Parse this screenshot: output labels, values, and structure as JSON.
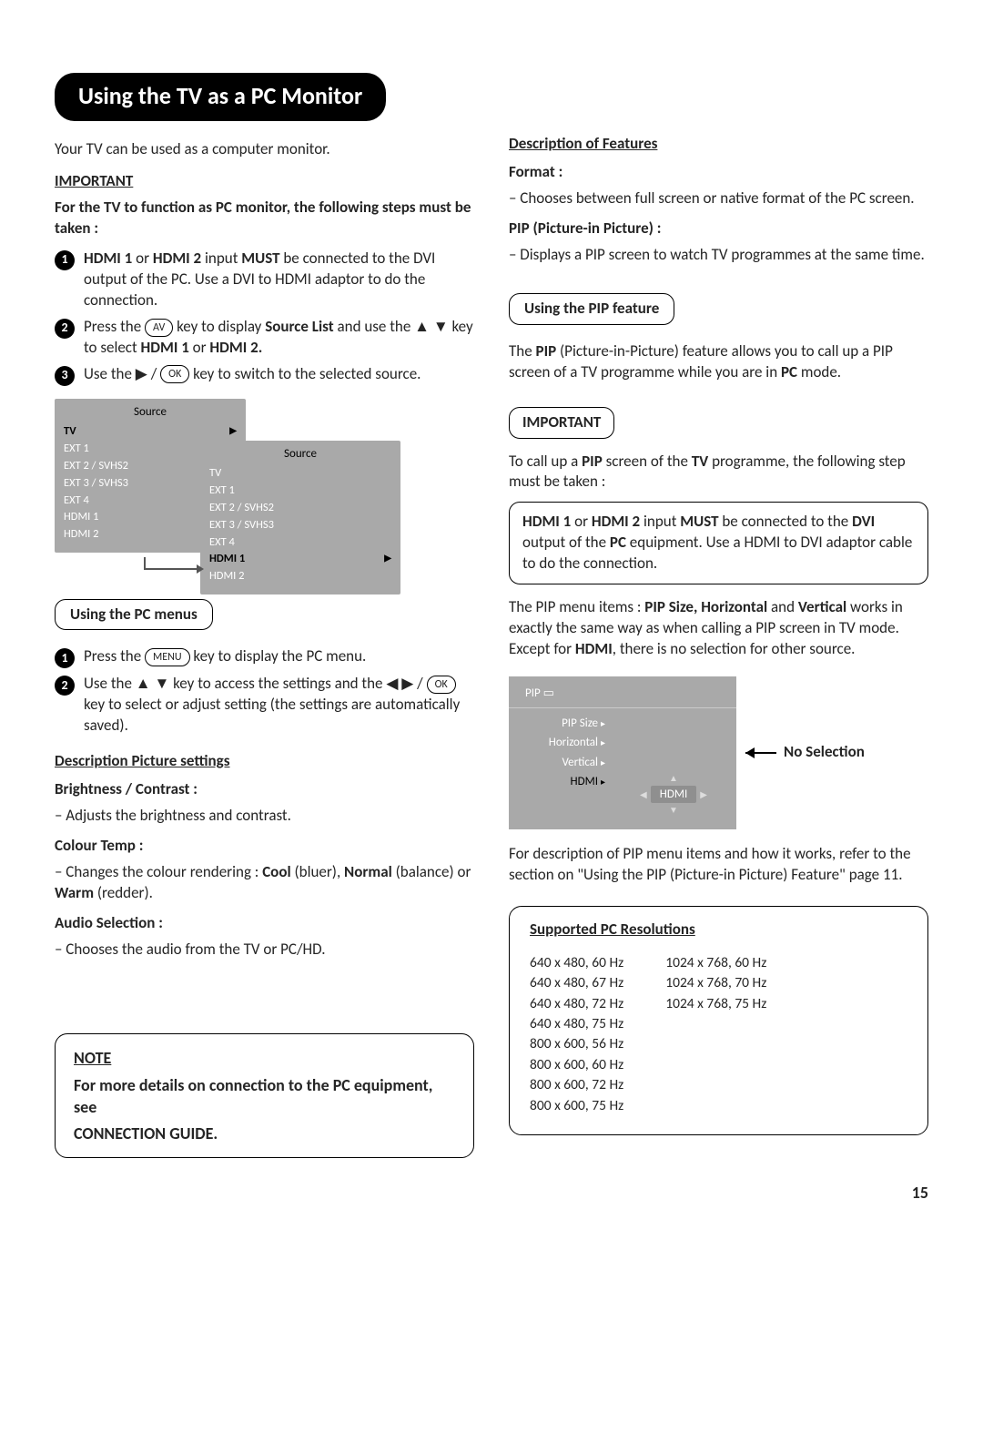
{
  "title": "Using the TV as a PC Monitor",
  "intro": "Your TV can be used as a computer monitor.",
  "important_label": "IMPORTANT",
  "important_text": "For the TV to function as PC monitor, the following steps must be taken :",
  "steps": {
    "s1_a": "HDMI 1",
    "s1_b": " or ",
    "s1_c": "HDMI 2",
    "s1_d": " input ",
    "s1_e": "MUST",
    "s1_f": " be connected to the DVI output of the PC. Use a DVI to HDMI adaptor to do the connection.",
    "s2_a": "Press the ",
    "s2_key": "AV",
    "s2_b": " key to display ",
    "s2_c": "Source List",
    "s2_d": " and use the ▲ ▼ key to select ",
    "s2_e": "HDMI 1",
    "s2_f": " or ",
    "s2_g": "HDMI 2.",
    "s3_a": "Use the ▶ / ",
    "s3_key": "OK",
    "s3_b": " key to switch to the selected source."
  },
  "osd": {
    "title": "Source",
    "items": [
      "TV",
      "EXT 1",
      "EXT 2 / SVHS2",
      "EXT 3 / SVHS3",
      "EXT 4",
      "HDMI 1",
      "HDMI 2"
    ],
    "sel1": "TV",
    "sel2": "HDMI 1"
  },
  "pc_menus_tab": "Using the PC menus",
  "pc_steps": {
    "p1_a": "Press the ",
    "p1_key": "MENU",
    "p1_b": " key to display the PC menu.",
    "p2_a": "Use the ▲ ▼ key to access the settings and the ◀ ▶  / ",
    "p2_key": "OK",
    "p2_b": " key to select or adjust setting (the settings are automatically saved)."
  },
  "desc_pic_h": "Description Picture settings",
  "bright_h": "Brightness / Contrast",
  "bright_t": "– Adjusts the brightness and contrast.",
  "colour_h": "Colour Temp",
  "colour_t_a": "– Changes the colour rendering : ",
  "colour_cool": "Cool",
  "colour_bluer": " (bluer), ",
  "colour_normal": "Normal",
  "colour_balance": " (balance) or ",
  "colour_warm": "Warm",
  "colour_redder": " (redder).",
  "audio_h": "Audio Selection",
  "audio_t": "– Chooses the audio from the TV or PC/HD.",
  "note_h": "NOTE",
  "note_t1": "For more details on connection to the PC equipment, see",
  "note_t2": "CONNECTION GUIDE.",
  "feat_h": "Description of Features",
  "format_h": "Format",
  "format_t": "– Chooses between full screen or native format of the PC screen.",
  "pip_h": "PIP (Picture-in Picture)",
  "pip_t": "– Displays a PIP screen to watch TV programmes at the same time.",
  "pip_tab": "Using the PIP feature",
  "pip_para_a": "The ",
  "pip_para_b": "PIP",
  "pip_para_c": " (Picture-in-Picture) feature allows you to call up a PIP screen of a TV programme while you are in ",
  "pip_para_d": "PC",
  "pip_para_e": " mode.",
  "important2": "IMPORTANT",
  "call_a": "To call up a ",
  "call_b": "PIP",
  "call_c": " screen of the ",
  "call_d": "TV",
  "call_e": " programme, the following step must be taken :",
  "hdmi_box_a": "HDMI 1",
  "hdmi_box_b": " or ",
  "hdmi_box_c": "HDMI 2",
  "hdmi_box_d": " input ",
  "hdmi_box_e": "MUST",
  "hdmi_box_f": " be connected to the ",
  "hdmi_box_g": "DVI",
  "hdmi_box_h": " output of the ",
  "hdmi_box_i": "PC",
  "hdmi_box_j": " equipment. Use a HDMI to DVI adaptor cable to do the connection.",
  "pipmenu_a": "The PIP menu items : ",
  "pipmenu_b": "PIP Size, Horizontal",
  "pipmenu_c": " and ",
  "pipmenu_d": "Vertical",
  "pipmenu_e": " works in exactly the same way as when calling a PIP screen in TV mode. Except for ",
  "pipmenu_f": "HDMI",
  "pipmenu_g": ", there is no selection for other source.",
  "pip_osd": {
    "title": "PIP",
    "rows": [
      "PIP Size",
      "Horizontal",
      "Vertical",
      "HDMI"
    ],
    "sel_val": "HDMI",
    "no_sel": "No Selection"
  },
  "pipdesc": "For description of PIP menu items and how it works, refer to the section on \"Using the  PIP (Picture-in Picture) Feature\" page 11.",
  "res_title": "Supported PC Resolutions",
  "res_col1": "640 x 480, 60 Hz\n640 x 480, 67 Hz\n640 x 480, 72 Hz\n640 x 480, 75 Hz\n800 x 600, 56 Hz\n800 x 600, 60 Hz\n800 x 600, 72 Hz\n800 x 600, 75 Hz",
  "res_col2": "1024 x 768, 60 Hz\n1024 x 768, 70 Hz\n1024 x 768, 75 Hz",
  "page_number": "15"
}
